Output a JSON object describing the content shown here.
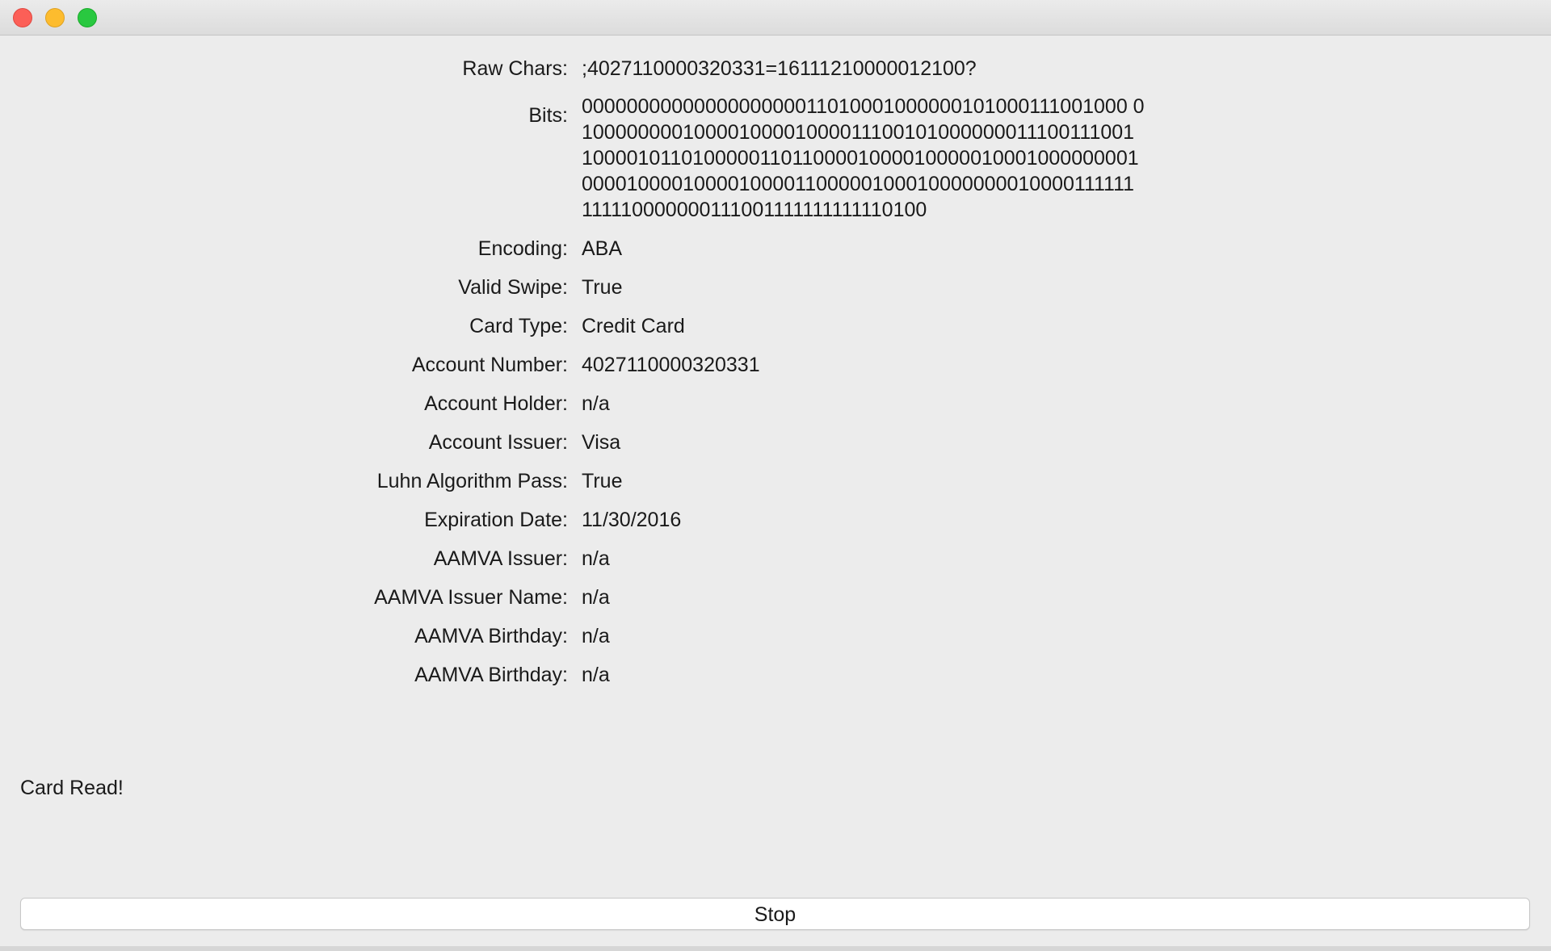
{
  "window": {
    "controls": [
      "close",
      "minimize",
      "zoom"
    ]
  },
  "fields": {
    "raw_chars": {
      "label": "Raw Chars:",
      "value": ";4027110000320331=16111210000012100?"
    },
    "bits": {
      "label": "Bits:",
      "lines": [
        "0000000000000000000011010001000000101000111001000 0",
        "10000000010000100001000011100101000000011100111001",
        "10000101101000001101100001000010000010001000000001",
        "00001000010000100001100000100010000000010000111111",
        "111110000000111001111111111110100"
      ]
    },
    "encoding": {
      "label": "Encoding:",
      "value": "ABA"
    },
    "valid_swipe": {
      "label": "Valid Swipe:",
      "value": "True"
    },
    "card_type": {
      "label": "Card Type:",
      "value": "Credit Card"
    },
    "account_number": {
      "label": "Account Number:",
      "value": "4027110000320331"
    },
    "account_holder": {
      "label": "Account Holder:",
      "value": "n/a"
    },
    "account_issuer": {
      "label": "Account Issuer:",
      "value": "Visa"
    },
    "luhn_pass": {
      "label": "Luhn Algorithm Pass:",
      "value": "True"
    },
    "expiration_date": {
      "label": "Expiration Date:",
      "value": "11/30/2016"
    },
    "aamva_issuer": {
      "label": "AAMVA Issuer:",
      "value": "n/a"
    },
    "aamva_issuer_name": {
      "label": "AAMVA Issuer Name:",
      "value": "n/a"
    },
    "aamva_birthday_1": {
      "label": "AAMVA Birthday:",
      "value": "n/a"
    },
    "aamva_birthday_2": {
      "label": "AAMVA Birthday:",
      "value": "n/a"
    }
  },
  "status": {
    "text": "Card Read!"
  },
  "actions": {
    "stop_label": "Stop"
  }
}
